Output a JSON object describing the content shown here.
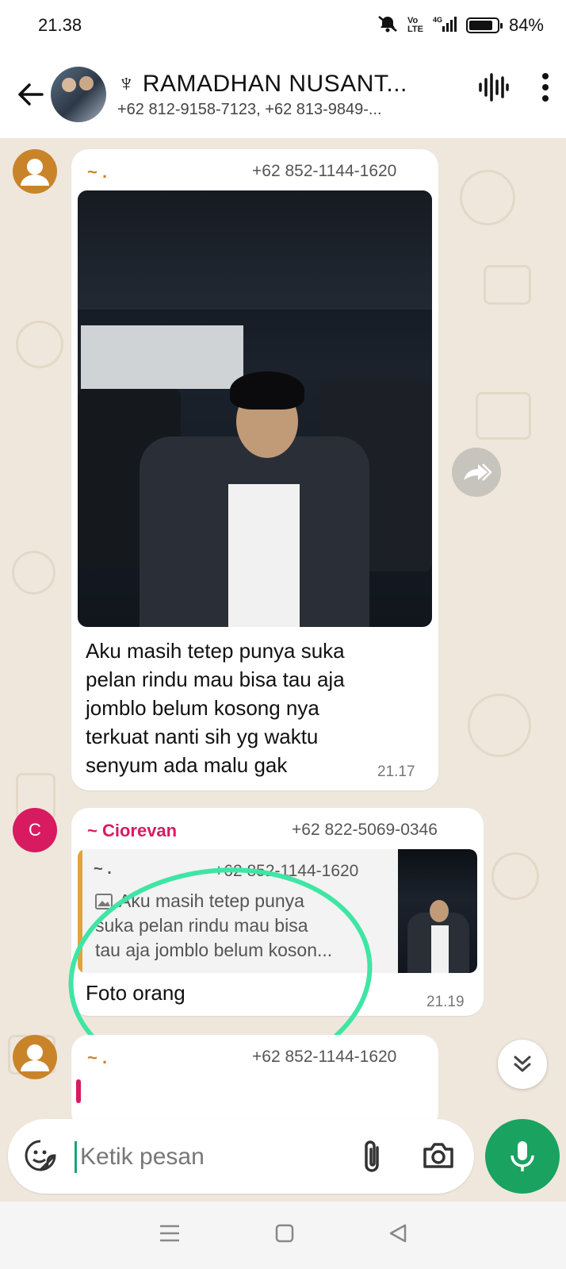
{
  "status_bar": {
    "time": "21.38",
    "network": "4G",
    "battery_percent": "84%",
    "battery_level": 0.84
  },
  "header": {
    "title": "♆ RAMADHAN NUSANT...",
    "subtitle": "+62 812-9158-7123, +62 813-9849-..."
  },
  "messages": [
    {
      "name": "~ .",
      "name_color": "#c9842a",
      "phone": "+62 852-1144-1620",
      "text_lines": [
        "Aku masih tetep punya suka",
        "pelan rindu mau bisa tau aja",
        "jomblo belum kosong nya",
        "terkuat nanti sih yg waktu",
        "senyum ada malu gak"
      ],
      "time": "21.17"
    },
    {
      "avatar_letter": "C",
      "name": "~ Ciorevan",
      "name_color": "#d81b60",
      "phone": "+62 822-5069-0346",
      "quote": {
        "name": "~ .",
        "phone": "+62 852-1144-1620",
        "lines": [
          "Aku masih tetep punya",
          "suka pelan rindu mau bisa",
          "tau aja jomblo belum koson..."
        ]
      },
      "text": "Foto orang",
      "time": "21.19"
    },
    {
      "name": "~ .",
      "phone": "+62 852-1144-1620"
    }
  ],
  "composer": {
    "placeholder": "Ketik pesan"
  },
  "colors": {
    "chat_bg": "#efe7dc",
    "accent_green": "#1aa260",
    "highlight": "#3fe5a4"
  }
}
